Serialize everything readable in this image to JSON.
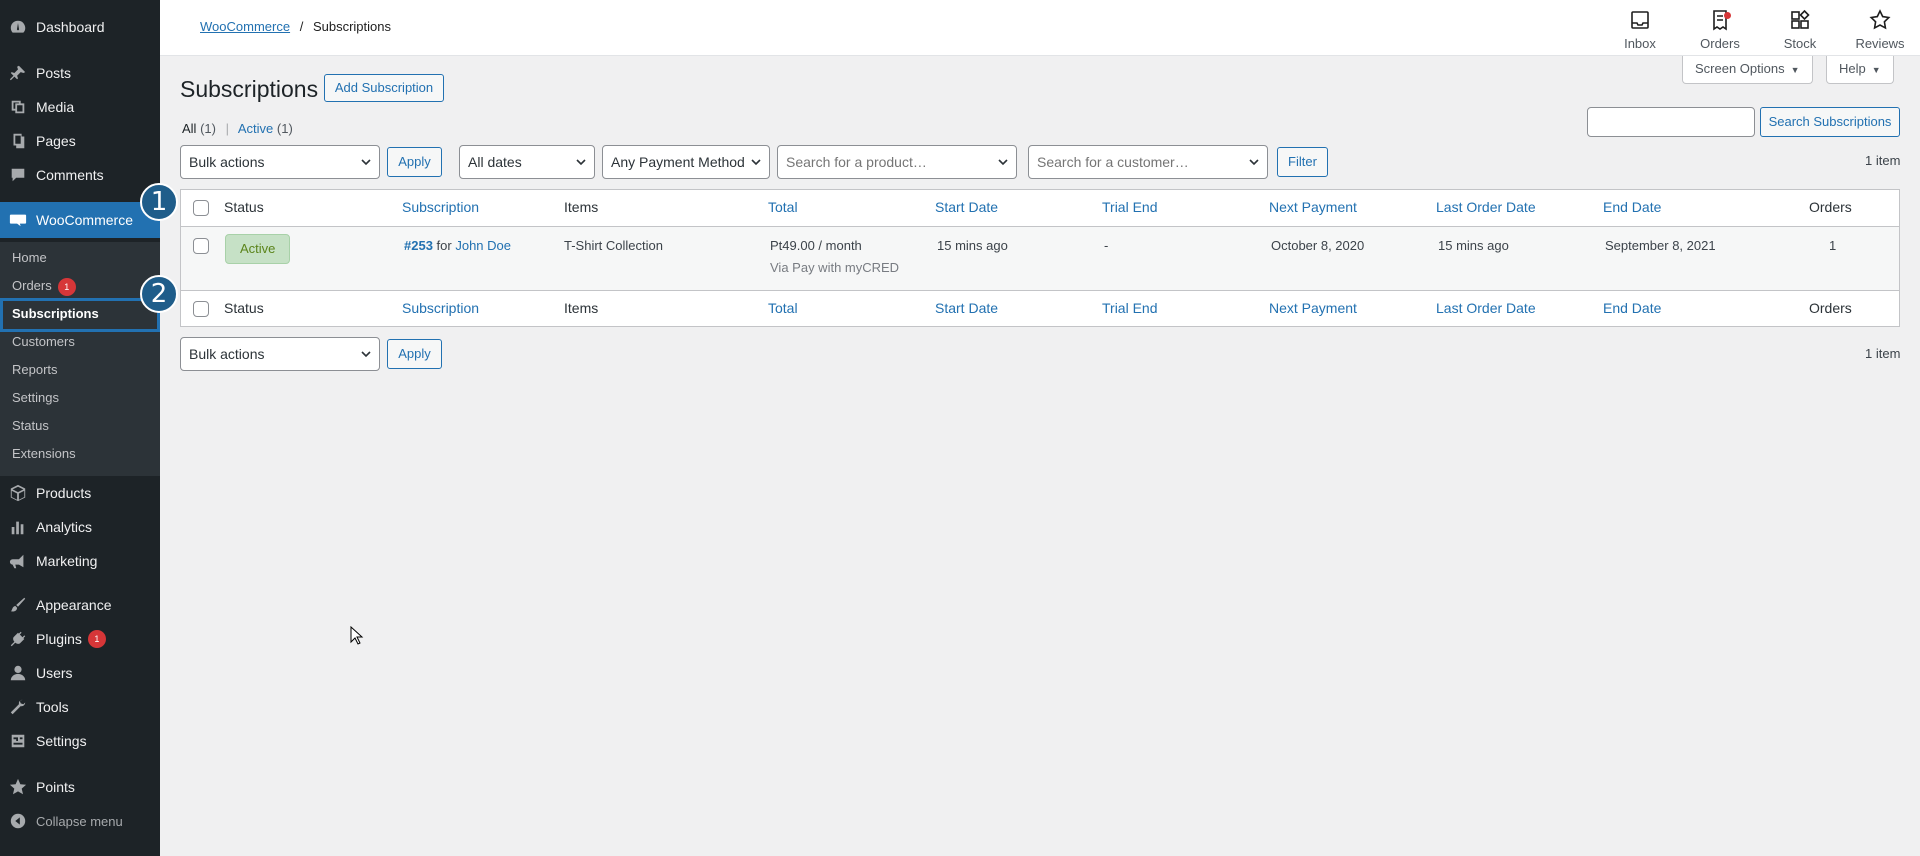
{
  "sidebar": {
    "menu": [
      {
        "label": "Dashboard",
        "icon": "dashboard-icon"
      },
      {
        "label": "Posts",
        "icon": "pin-icon"
      },
      {
        "label": "Media",
        "icon": "media-icon"
      },
      {
        "label": "Pages",
        "icon": "pages-icon"
      },
      {
        "label": "Comments",
        "icon": "comment-icon"
      },
      {
        "label": "WooCommerce",
        "icon": "woo-icon"
      },
      {
        "label": "Products",
        "icon": "box-icon"
      },
      {
        "label": "Analytics",
        "icon": "bar-chart-icon"
      },
      {
        "label": "Marketing",
        "icon": "megaphone-icon"
      },
      {
        "label": "Appearance",
        "icon": "brush-icon"
      },
      {
        "label": "Plugins",
        "icon": "plug-icon",
        "badge": "1"
      },
      {
        "label": "Users",
        "icon": "user-icon"
      },
      {
        "label": "Tools",
        "icon": "wrench-icon"
      },
      {
        "label": "Settings",
        "icon": "settings-icon"
      },
      {
        "label": "Points",
        "icon": "star-icon"
      }
    ],
    "submenu": [
      {
        "label": "Home"
      },
      {
        "label": "Orders",
        "badge": "1"
      },
      {
        "label": "Subscriptions"
      },
      {
        "label": "Customers"
      },
      {
        "label": "Reports"
      },
      {
        "label": "Settings"
      },
      {
        "label": "Status"
      },
      {
        "label": "Extensions"
      }
    ],
    "collapse_label": "Collapse menu",
    "steps": [
      "1",
      "2"
    ]
  },
  "header": {
    "breadcrumb_link": "WooCommerce",
    "breadcrumb_sep": "/",
    "breadcrumb_current": "Subscriptions",
    "buttons": [
      {
        "label": "Inbox",
        "icon": "inbox-icon"
      },
      {
        "label": "Orders",
        "icon": "orders-icon"
      },
      {
        "label": "Stock",
        "icon": "stock-icon"
      },
      {
        "label": "Reviews",
        "icon": "star-outline-icon"
      }
    ]
  },
  "main": {
    "screen_options": "Screen Options",
    "help": "Help",
    "title": "Subscriptions",
    "add_button": "Add Subscription",
    "views": {
      "all": "All",
      "all_count": "(1)",
      "sep": "|",
      "active": "Active",
      "active_count": "(1)"
    },
    "search_button": "Search Subscriptions",
    "search_value": "",
    "filters": {
      "bulk": "Bulk actions",
      "apply": "Apply",
      "dates": "All dates",
      "payment": "Any Payment Method",
      "product_placeholder": "Search for a product…",
      "customer_placeholder": "Search for a customer…",
      "filter": "Filter"
    },
    "item_count": "1 item",
    "columns": [
      "Status",
      "Subscription",
      "Items",
      "Total",
      "Start Date",
      "Trial End",
      "Next Payment",
      "Last Order Date",
      "End Date",
      "Orders"
    ],
    "rows": [
      {
        "status": "Active",
        "sub_number": "#253",
        "sub_for": "for",
        "sub_customer": "John Doe",
        "items": "T-Shirt Collection",
        "total": "Pt49.00 / month",
        "total_via": "Via Pay with myCRED",
        "start_date": "15 mins ago",
        "trial_end": "-",
        "next_payment": "October 8, 2020",
        "last_order_date": "15 mins ago",
        "end_date": "September 8, 2021",
        "orders": "1"
      }
    ],
    "bottom_bulk": "Bulk actions",
    "bottom_apply": "Apply",
    "bottom_count": "1 item"
  },
  "colors": {
    "accent": "#2271b1",
    "sidebar": "#1d2327",
    "status_active_bg": "#c6e1c6",
    "badge": "#d63638"
  }
}
